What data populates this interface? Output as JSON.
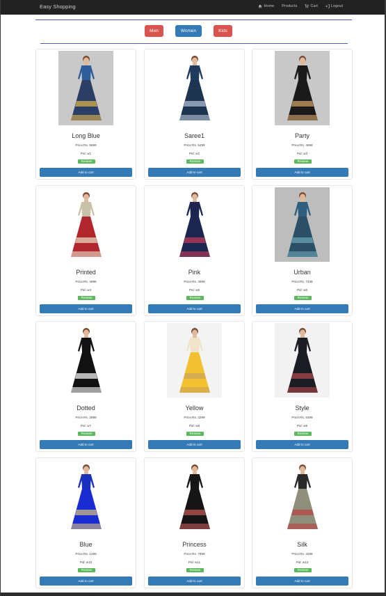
{
  "navbar": {
    "brand": "Easy Shopping",
    "links": [
      {
        "label": "Home",
        "icon": "home-icon"
      },
      {
        "label": "Products",
        "icon": ""
      },
      {
        "label": "Cart",
        "icon": "cart-icon"
      },
      {
        "label": "Logout",
        "icon": "logout-icon"
      }
    ]
  },
  "categories": {
    "men": "Men",
    "women": "Women",
    "kids": "Kids"
  },
  "colors": {
    "navbar": "#222222",
    "danger": "#d9534f",
    "primary": "#337ab7",
    "success": "#5cb85c",
    "rule": "#4a5fb8"
  },
  "products": [
    {
      "name": "Long Blue",
      "price": "Price:Rs. 5999",
      "pid": "Pid: w1",
      "reviews": "Reviews",
      "cart": "Add to cart"
    },
    {
      "name": "Saree1",
      "price": "Price:Rs. 5499",
      "pid": "Pid: w2",
      "reviews": "Reviews",
      "cart": "Add to cart"
    },
    {
      "name": "Party",
      "price": "Price:Rs. 4699",
      "pid": "Pid: w3",
      "reviews": "Reviews",
      "cart": "Add to cart"
    },
    {
      "name": "Printed",
      "price": "Price:Rs. 4999",
      "pid": "Pid: w4",
      "reviews": "Reviews",
      "cart": "Add to cart"
    },
    {
      "name": "Pink",
      "price": "Price:Rs. 4999",
      "pid": "Pid: w5",
      "reviews": "Reviews",
      "cart": "Add to cart"
    },
    {
      "name": "Urban",
      "price": "Price:Rs. 7339",
      "pid": "Pid: w6",
      "reviews": "Reviews",
      "cart": "Add to cart"
    },
    {
      "name": "Dotted",
      "price": "Price:Rs. 2999",
      "pid": "Pid: w7",
      "reviews": "Reviews",
      "cart": "Add to cart"
    },
    {
      "name": "Yellow",
      "price": "Price:Rs. 3299",
      "pid": "Pid: w8",
      "reviews": "Reviews",
      "cart": "Add to cart"
    },
    {
      "name": "Style",
      "price": "Price:Rs. 5499",
      "pid": "Pid: w9",
      "reviews": "Reviews",
      "cart": "Add to cart"
    },
    {
      "name": "Blue",
      "price": "Price:Rs. 1299",
      "pid": "Pid: w10",
      "reviews": "Reviews",
      "cart": "Add to cart"
    },
    {
      "name": "Princess",
      "price": "Price:Rs. 7999",
      "pid": "Pid: w11",
      "reviews": "Reviews",
      "cart": "Add to cart"
    },
    {
      "name": "Silk",
      "price": "Price:Rs. 4299",
      "pid": "Pid: w12",
      "reviews": "Reviews",
      "cart": "Add to cart"
    }
  ]
}
